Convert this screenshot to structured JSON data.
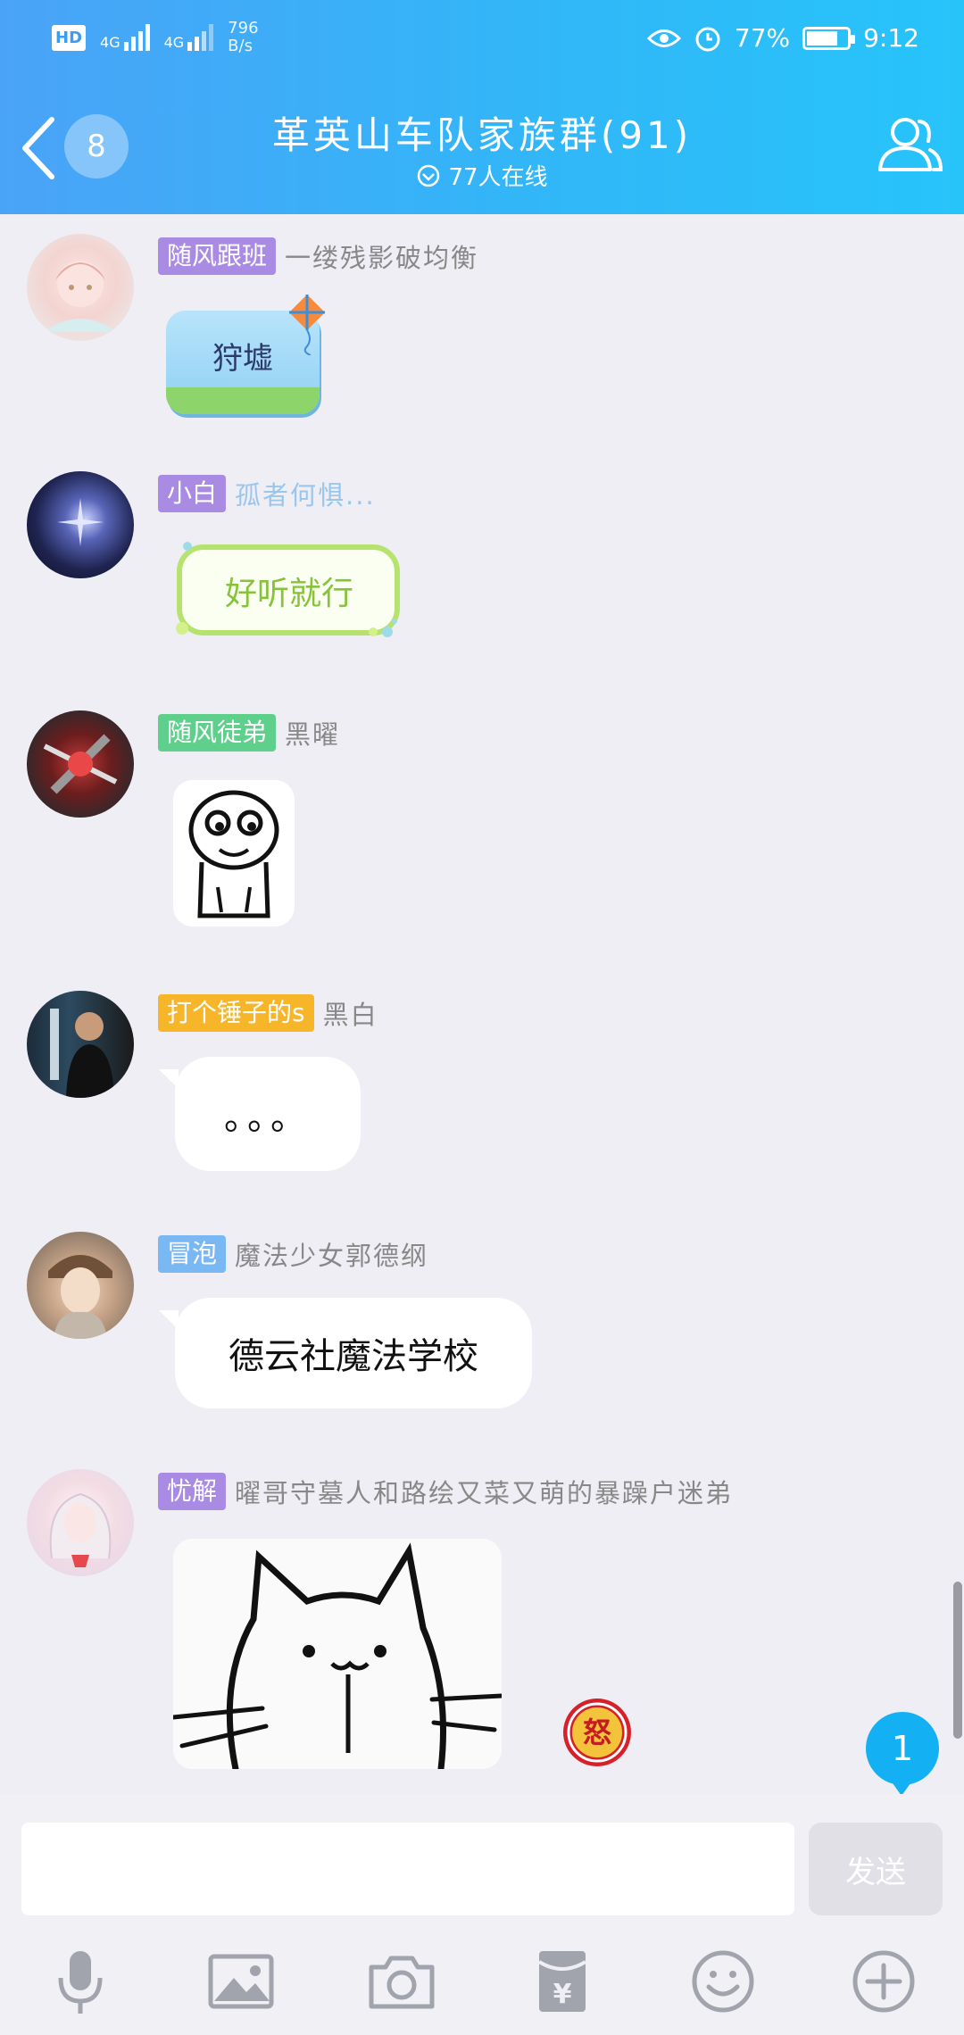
{
  "status_bar": {
    "hd": "HD",
    "net1": "4G",
    "net2": "4G",
    "speed_value": "796",
    "speed_unit": "B/s",
    "battery_percent": 77,
    "battery_text": "77%",
    "time": "9:12"
  },
  "header": {
    "unread_count": "8",
    "title": "革英山车队家族群(91)",
    "subtitle": "77人在线"
  },
  "messages": [
    {
      "tag": "随风跟班",
      "tag_color": "#a98be3",
      "nick": "一缕残影破均衡",
      "content_type": "sticker",
      "content": "狩墟"
    },
    {
      "tag": "小白",
      "tag_color": "#a98be3",
      "nick": "孤者何惧...",
      "nick_color": "#9bc6ec",
      "content_type": "sticker",
      "content": "好听就行"
    },
    {
      "tag": "随风徒弟",
      "tag_color": "#5fcf8c",
      "nick": "黑曜",
      "content_type": "sticker",
      "content": ""
    },
    {
      "tag": "打个锤子的s",
      "tag_color": "#f7b52a",
      "nick": "黑白",
      "content_type": "text",
      "content": "。。。"
    },
    {
      "tag": "冒泡",
      "tag_color": "#79b8f2",
      "nick": "魔法少女郭德纲",
      "content_type": "text",
      "content": "德云社魔法学校"
    },
    {
      "tag": "忧解",
      "tag_color": "#a98be3",
      "nick": "曜哥守墓人和路绘又菜又萌的暴躁户迷弟",
      "content_type": "sticker",
      "content": ""
    }
  ],
  "floaters": {
    "new_message_count": "1",
    "angry_char": "怒"
  },
  "input": {
    "placeholder": "",
    "send_label": "发送"
  },
  "toolbar_icons": [
    "microphone-icon",
    "image-icon",
    "camera-icon",
    "red-packet-icon",
    "emoji-icon",
    "plus-icon"
  ]
}
